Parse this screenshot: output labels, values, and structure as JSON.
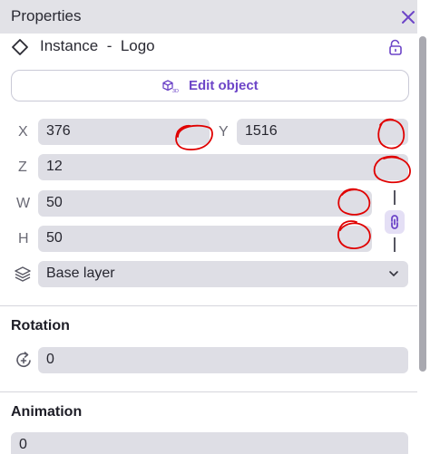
{
  "header": {
    "title": "Properties",
    "close_icon": "close-icon"
  },
  "instance": {
    "label": "Instance  -  Logo",
    "type_icon": "diamond-icon",
    "lock_icon": "lock-icon"
  },
  "edit_button": {
    "label": "Edit object",
    "icon": "cube-3d-icon"
  },
  "transform": {
    "x": {
      "label": "X",
      "value": "376"
    },
    "y": {
      "label": "Y",
      "value": "1516"
    },
    "z": {
      "label": "Z",
      "value": "12"
    },
    "w": {
      "label": "W",
      "value": "50"
    },
    "h": {
      "label": "H",
      "value": "50"
    },
    "link_icon": "chain-link-icon"
  },
  "layer": {
    "icon": "layers-icon",
    "value": "Base layer"
  },
  "rotation": {
    "title": "Rotation",
    "icon": "rotate-icon",
    "value": "0"
  },
  "animation": {
    "title": "Animation",
    "value": "0"
  },
  "colors": {
    "accent": "#6d45c8",
    "field_bg": "#dedee5",
    "header_bg": "#e2e2e7",
    "annotation": "#e00000"
  }
}
